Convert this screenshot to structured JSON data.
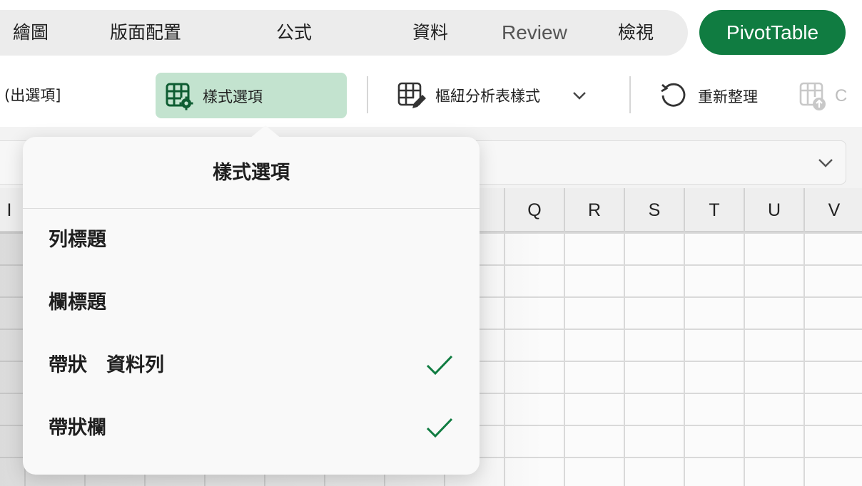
{
  "tabs": {
    "draw": "繪圖",
    "page_layout": "版面配置",
    "formulas": "公式",
    "data": "資料",
    "review": "Review",
    "view": "檢視",
    "pivot_table": "PivotTable"
  },
  "ribbon": {
    "show_options_partial": "(出選項]",
    "style_options": "樣式選項",
    "pivot_styles": "樞紐分析表樣式",
    "refresh": "重新整理",
    "truncated_partial": "C"
  },
  "sheet": {
    "columns": [
      "Q",
      "R",
      "S",
      "T",
      "U",
      "V"
    ],
    "partial_column": "I"
  },
  "popover": {
    "title": "樣式選項",
    "options": [
      {
        "label": "列標題",
        "checked": false
      },
      {
        "label": "欄標題",
        "checked": false
      },
      {
        "label": "帶狀　資料列",
        "checked": true
      },
      {
        "label": "帶狀欄",
        "checked": true
      }
    ]
  },
  "colors": {
    "accent": "#107c41",
    "selected_button": "#c3e3cf",
    "check": "#107c41"
  },
  "icons": {
    "style_options": "table-gear-icon",
    "pivot_styles": "table-pencil-icon",
    "refresh": "refresh-icon",
    "dropdown": "chevron-down-icon",
    "check": "checkmark-icon"
  }
}
